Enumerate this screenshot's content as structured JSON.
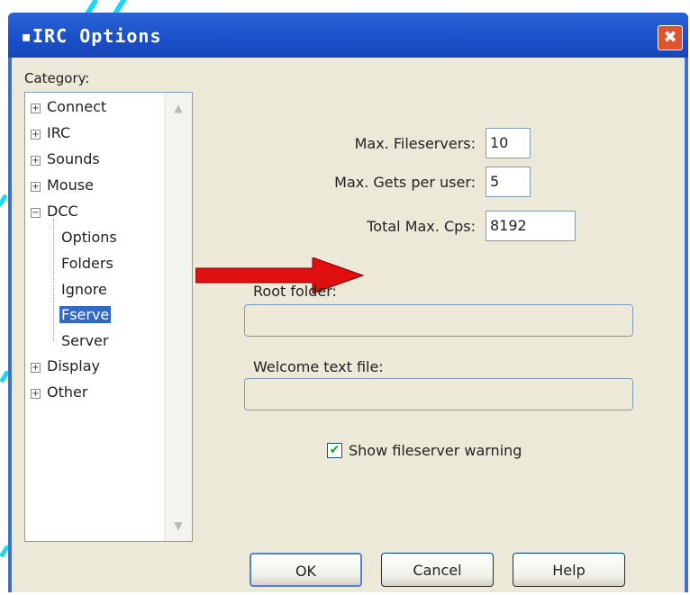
{
  "window": {
    "title": "▪IRC Options",
    "close_glyph": "✖"
  },
  "category": {
    "label": "Category:",
    "items": [
      {
        "label": "Connect",
        "expander": "+"
      },
      {
        "label": "IRC",
        "expander": "+"
      },
      {
        "label": "Sounds",
        "expander": "+"
      },
      {
        "label": "Mouse",
        "expander": "+"
      },
      {
        "label": "DCC",
        "expander": "−"
      },
      {
        "label": "Display",
        "expander": "+"
      },
      {
        "label": "Other",
        "expander": "+"
      }
    ],
    "dcc_children": [
      "Options",
      "Folders",
      "Ignore",
      "Fserve",
      "Server"
    ],
    "selected": "Fserve"
  },
  "fserve": {
    "max_fileservers_label": "Max. Fileservers:",
    "max_fileservers_value": "10",
    "max_gets_label": "Max. Gets per user:",
    "max_gets_value": "5",
    "total_cps_label": "Total Max. Cps:",
    "total_cps_value": "8192",
    "root_folder_label": "Root folder:",
    "root_folder_value": "",
    "welcome_label": "Welcome text file:",
    "welcome_value": "",
    "show_warning_label": "Show fileserver warning",
    "show_warning_checked": true
  },
  "buttons": {
    "ok": "OK",
    "cancel": "Cancel",
    "help": "Help"
  },
  "colors": {
    "titlebar": "#1a4fc9",
    "arrow": "#e01010",
    "selection": "#316ac5"
  }
}
